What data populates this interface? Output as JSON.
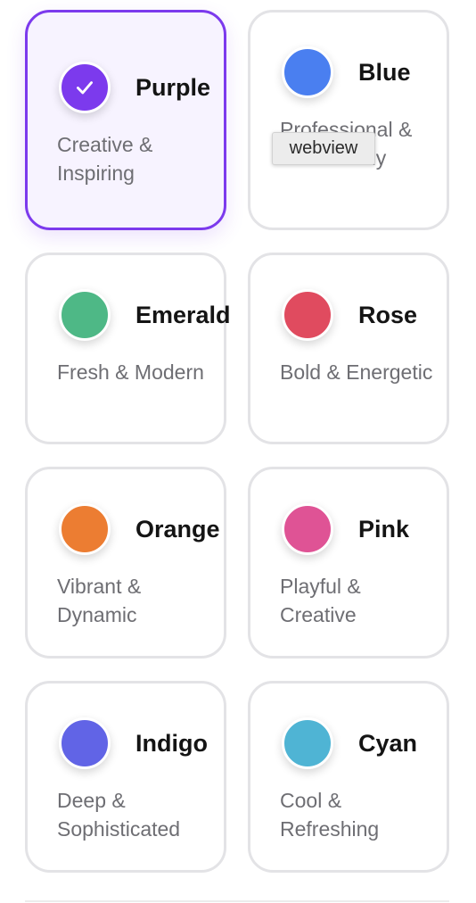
{
  "colors": [
    {
      "name": "Purple",
      "description": "Creative & Inspiring",
      "color": "#7c3aed",
      "selected": true,
      "icon": "check-icon"
    },
    {
      "name": "Blue",
      "description": "Professional & Trustworthy",
      "color": "#4a7ff0",
      "selected": false
    },
    {
      "name": "Emerald",
      "description": "Fresh & Modern",
      "color": "#4eb886",
      "selected": false
    },
    {
      "name": "Rose",
      "description": "Bold & Energetic",
      "color": "#e04b5f",
      "selected": false
    },
    {
      "name": "Orange",
      "description": "Vibrant & Dynamic",
      "color": "#ec7d32",
      "selected": false
    },
    {
      "name": "Pink",
      "description": "Playful & Creative",
      "color": "#df5395",
      "selected": false
    },
    {
      "name": "Indigo",
      "description": "Deep & Sophisticated",
      "color": "#6164e6",
      "selected": false
    },
    {
      "name": "Cyan",
      "description": "Cool & Refreshing",
      "color": "#4fb4d4",
      "selected": false
    }
  ],
  "tooltip": {
    "text": "webview"
  }
}
